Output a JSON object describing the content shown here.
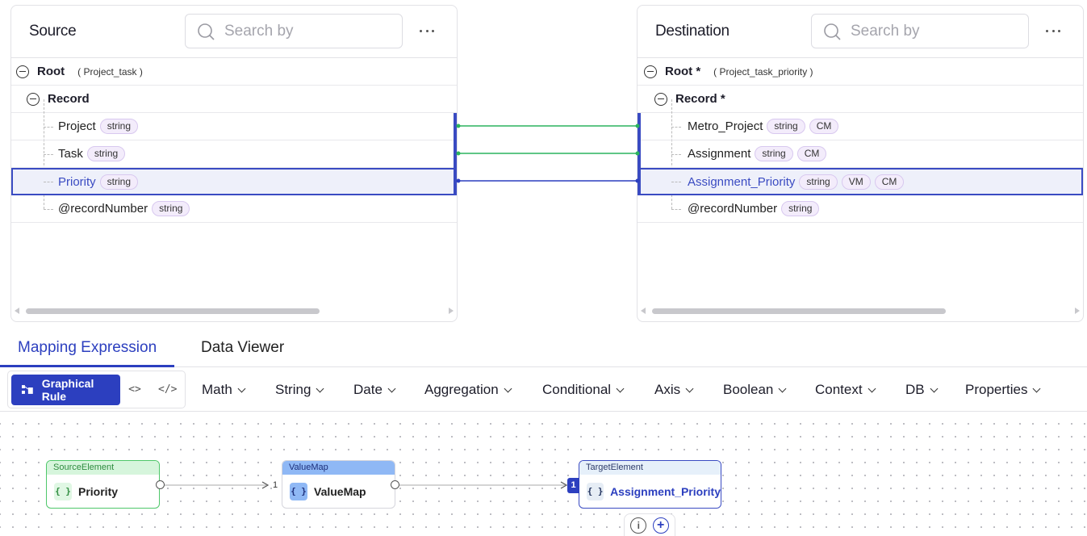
{
  "source": {
    "title": "Source",
    "search_placeholder": "Search by",
    "root_label": "Root",
    "root_type": "( Project_task )",
    "record_label": "Record",
    "fields": [
      {
        "name": "Project",
        "tags": [
          "string"
        ]
      },
      {
        "name": "Task",
        "tags": [
          "string"
        ]
      },
      {
        "name": "Priority",
        "tags": [
          "string"
        ],
        "selected": true
      },
      {
        "name": "@recordNumber",
        "tags": [
          "string"
        ]
      }
    ]
  },
  "destination": {
    "title": "Destination",
    "search_placeholder": "Search by",
    "root_label": "Root *",
    "root_type": "( Project_task_priority )",
    "record_label": "Record *",
    "fields": [
      {
        "name": "Metro_Project",
        "tags": [
          "string",
          "CM"
        ]
      },
      {
        "name": "Assignment",
        "tags": [
          "string",
          "CM"
        ]
      },
      {
        "name": "Assignment_Priority",
        "tags": [
          "string",
          "VM",
          "CM"
        ],
        "selected": true
      },
      {
        "name": "@recordNumber",
        "tags": [
          "string"
        ]
      }
    ]
  },
  "connector_colors": {
    "mapped": "#2bb35e",
    "selected": "#2c3fbf"
  },
  "tabs": [
    {
      "label": "Mapping Expression",
      "active": true
    },
    {
      "label": "Data Viewer",
      "active": false
    }
  ],
  "toolbar": {
    "graphical_rule_label": "Graphical Rule",
    "code_icon_1": "<>",
    "code_icon_2": "</>",
    "menus": [
      "Math",
      "String",
      "Date",
      "Aggregation",
      "Conditional",
      "Axis",
      "Boolean",
      "Context",
      "DB",
      "Properties"
    ]
  },
  "canvas": {
    "source_node": {
      "type": "SourceElement",
      "label": "Priority",
      "icon": "{ }"
    },
    "valuemap_node": {
      "type": "ValueMap",
      "label": "ValueMap",
      "icon": "{ }",
      "input_index": "1"
    },
    "target_node": {
      "type": "TargetElement",
      "label": "Assignment_Priority",
      "icon": "{ }",
      "input_index": "1"
    },
    "info_icon": "i",
    "add_icon": "+"
  }
}
